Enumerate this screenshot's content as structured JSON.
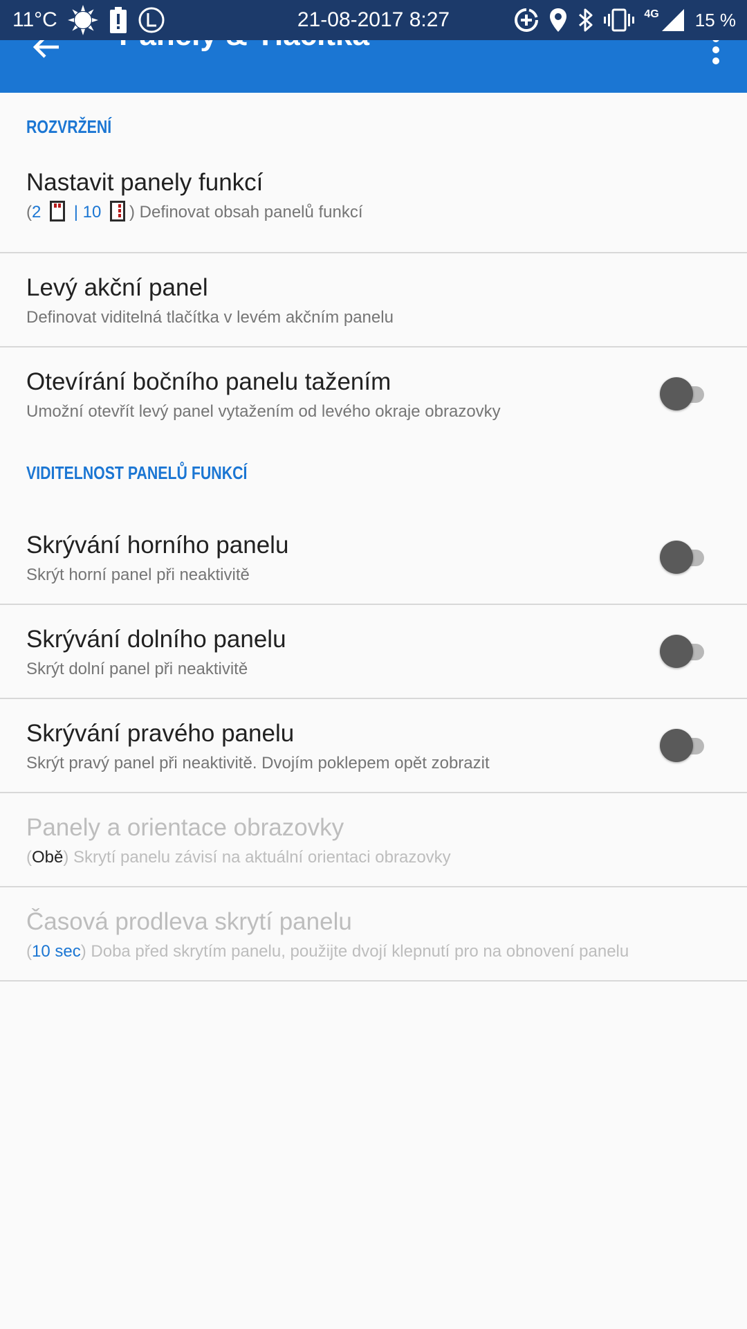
{
  "status_bar": {
    "temperature": "11°C",
    "datetime": "21-08-2017 8:27",
    "network": "4G",
    "battery": "15 %"
  },
  "app_bar": {
    "title": "Panely & Tlačítka"
  },
  "sections": {
    "layout_header": "ROZVRŽENÍ",
    "visibility_header": "VIDITELNOST PANELŮ FUNKCÍ"
  },
  "prefs": {
    "function_panels": {
      "title": "Nastavit panely funkcí",
      "count_horizontal": "2",
      "separator": "|",
      "count_vertical": "10",
      "summary": "Definovat obsah panelů funkcí",
      "open_paren": "(",
      "close_paren": ")"
    },
    "left_action_panel": {
      "title": "Levý akční panel",
      "summary": "Definovat viditelná tlačítka v levém akčním panelu"
    },
    "swipe_side_panel": {
      "title": "Otevírání bočního panelu tažením",
      "summary": "Umožní otevřít levý panel vytažením od levého okraje obrazovky",
      "enabled": false
    },
    "hide_top_panel": {
      "title": "Skrývání horního panelu",
      "summary": "Skrýt horní panel při neaktivitě",
      "enabled": false
    },
    "hide_bottom_panel": {
      "title": "Skrývání dolního panelu",
      "summary": "Skrýt dolní panel při neaktivitě",
      "enabled": false
    },
    "hide_right_panel": {
      "title": "Skrývání pravého panelu",
      "summary": "Skrýt pravý panel při neaktivitě. Dvojím poklepem opět zobrazit",
      "enabled": false
    },
    "panels_orientation": {
      "title": "Panely a orientace obrazovky",
      "value": "Obě",
      "summary": "Skrytí panelu závisí na aktuální orientaci obrazovky",
      "open_paren": "(",
      "close_paren": ")"
    },
    "hide_delay": {
      "title": "Časová prodleva skrytí panelu",
      "value": "10 sec",
      "summary": "Doba před skrytím panelu, použijte dvojí klepnutí pro na obnovení panelu",
      "open_paren": "(",
      "close_paren": ")"
    }
  },
  "colors": {
    "status_bar": "#1c3a6a",
    "app_bar": "#1b76d3",
    "accent": "#1b76d3",
    "background": "#fafafa",
    "divider": "#d8d8d8",
    "panel_mark": "#b71c1c"
  },
  "icons": {
    "status_left": [
      "sun-icon",
      "battery-alert-icon",
      "l-circle-icon"
    ],
    "status_right": [
      "data-saver-icon",
      "location-icon",
      "bluetooth-icon",
      "vibrate-icon",
      "signal-icon"
    ],
    "app_bar": [
      "back-arrow-icon",
      "more-vert-icon"
    ]
  }
}
